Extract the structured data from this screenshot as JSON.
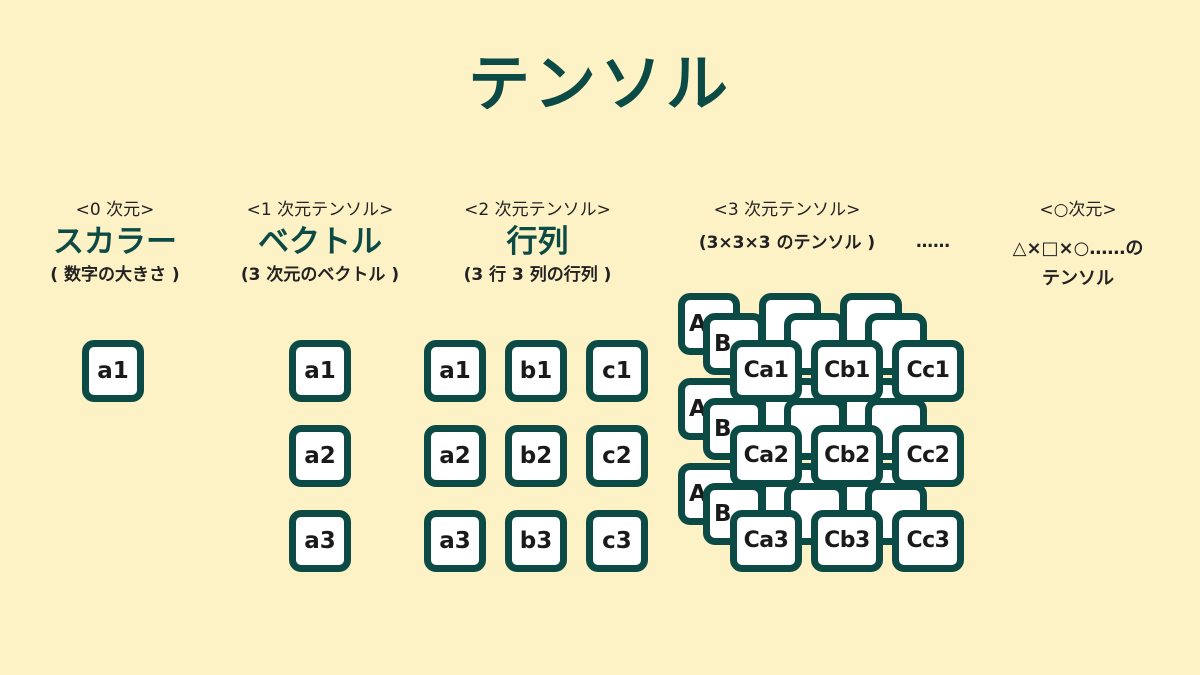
{
  "title": "テンソル",
  "columns": [
    {
      "tag": "<0 次元>",
      "name": "スカラー",
      "sub": "( 数字の大きさ )"
    },
    {
      "tag": "<1 次元テンソル>",
      "name": "ベクトル",
      "sub": "(3 次元のベクトル )"
    },
    {
      "tag": "<2 次元テンソル>",
      "name": "行列",
      "sub": "(3 行 3 列の行列 )"
    },
    {
      "tag": "<3 次元テンソル>",
      "sub": "(3×3×3 のテンソル )"
    },
    {
      "tag": "<○次元>"
    }
  ],
  "dots": "……",
  "ellipsis_note": {
    "line1": "△×□×○……の",
    "line2": "テンソル"
  },
  "scalar": [
    "a1"
  ],
  "vector": [
    "a1",
    "a2",
    "a3"
  ],
  "matrix": [
    [
      "a1",
      "b1",
      "c1"
    ],
    [
      "a2",
      "b2",
      "c2"
    ],
    [
      "a3",
      "b3",
      "c3"
    ]
  ],
  "tensor": {
    "back_labels": [
      "A",
      "A",
      "A"
    ],
    "middle_labels": [
      "B",
      "B",
      "B"
    ],
    "front": [
      [
        "Ca1",
        "Cb1",
        "Cc1"
      ],
      [
        "Ca2",
        "Cb2",
        "Cc2"
      ],
      [
        "Ca3",
        "Cb3",
        "Cc3"
      ]
    ]
  }
}
